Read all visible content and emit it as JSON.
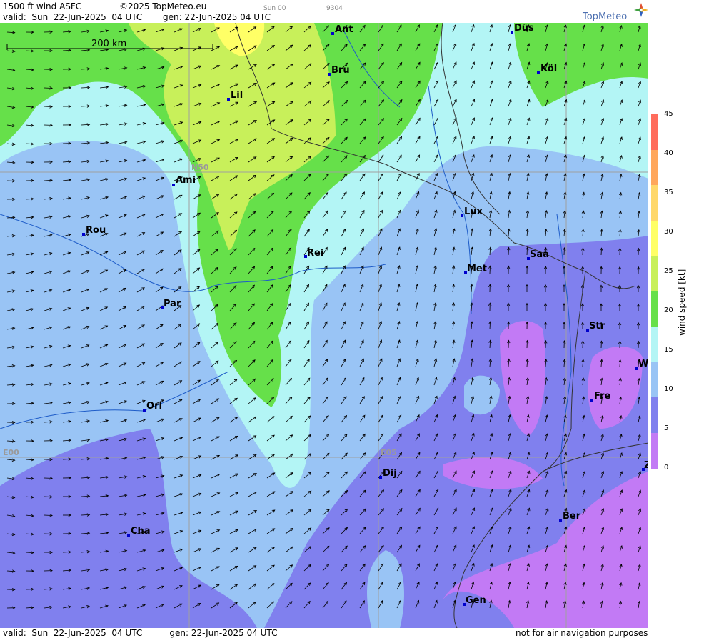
{
  "header": {
    "title": "1500 ft wind ASFC",
    "copyright": "©2025 TopMeteo.eu",
    "valid": "valid:  Sun  22-Jun-2025  04 UTC",
    "generated": "gen: 22-Jun-2025 04 UTC",
    "run_tag": "Sun 00",
    "code": "9304"
  },
  "logo": {
    "text": "TopMeteo"
  },
  "scale_bar": {
    "label": "200 km"
  },
  "grid_labels": {
    "lat": "N50",
    "lon0": "E00",
    "lon5": "E05"
  },
  "cities": [
    {
      "name": "Ant"
    },
    {
      "name": "Düs"
    },
    {
      "name": "Bru"
    },
    {
      "name": "Köl"
    },
    {
      "name": "Lil"
    },
    {
      "name": "Ami"
    },
    {
      "name": "Rou"
    },
    {
      "name": "Lux"
    },
    {
      "name": "Saa"
    },
    {
      "name": "Rei"
    },
    {
      "name": "Met"
    },
    {
      "name": "Par"
    },
    {
      "name": "Str"
    },
    {
      "name": "W"
    },
    {
      "name": "Fre"
    },
    {
      "name": "Orl"
    },
    {
      "name": "Dij"
    },
    {
      "name": "Z"
    },
    {
      "name": "Ber"
    },
    {
      "name": "Cha"
    },
    {
      "name": "Gen"
    }
  ],
  "legend": {
    "title": "wind  speed  [kt]",
    "ticks": [
      "45",
      "40",
      "35",
      "30",
      "25",
      "20",
      "15",
      "10",
      "5",
      "0"
    ],
    "colors": [
      "#ff6c5c",
      "#ffa75c",
      "#ffd86b",
      "#ffff66",
      "#c8f05a",
      "#66e04a",
      "#b3f5f5",
      "#99c4f5",
      "#8080ee",
      "#c27af5"
    ]
  },
  "footer": {
    "valid": "valid:  Sun  22-Jun-2025  04 UTC",
    "generated": "gen: 22-Jun-2025 04 UTC",
    "disclaimer": "not for air navigation purposes"
  }
}
